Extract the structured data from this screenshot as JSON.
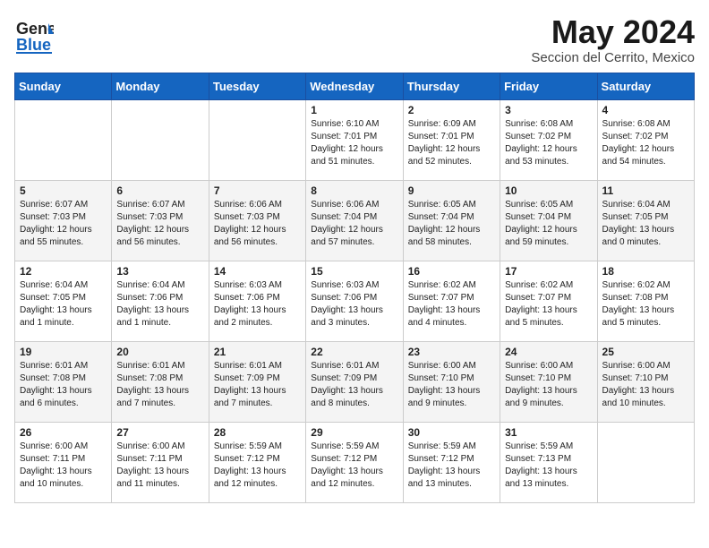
{
  "header": {
    "logo_line1": "General",
    "logo_line2": "Blue",
    "month": "May 2024",
    "location": "Seccion del Cerrito, Mexico"
  },
  "days_of_week": [
    "Sunday",
    "Monday",
    "Tuesday",
    "Wednesday",
    "Thursday",
    "Friday",
    "Saturday"
  ],
  "weeks": [
    [
      {
        "day": "",
        "info": ""
      },
      {
        "day": "",
        "info": ""
      },
      {
        "day": "",
        "info": ""
      },
      {
        "day": "1",
        "info": "Sunrise: 6:10 AM\nSunset: 7:01 PM\nDaylight: 12 hours\nand 51 minutes."
      },
      {
        "day": "2",
        "info": "Sunrise: 6:09 AM\nSunset: 7:01 PM\nDaylight: 12 hours\nand 52 minutes."
      },
      {
        "day": "3",
        "info": "Sunrise: 6:08 AM\nSunset: 7:02 PM\nDaylight: 12 hours\nand 53 minutes."
      },
      {
        "day": "4",
        "info": "Sunrise: 6:08 AM\nSunset: 7:02 PM\nDaylight: 12 hours\nand 54 minutes."
      }
    ],
    [
      {
        "day": "5",
        "info": "Sunrise: 6:07 AM\nSunset: 7:03 PM\nDaylight: 12 hours\nand 55 minutes."
      },
      {
        "day": "6",
        "info": "Sunrise: 6:07 AM\nSunset: 7:03 PM\nDaylight: 12 hours\nand 56 minutes."
      },
      {
        "day": "7",
        "info": "Sunrise: 6:06 AM\nSunset: 7:03 PM\nDaylight: 12 hours\nand 56 minutes."
      },
      {
        "day": "8",
        "info": "Sunrise: 6:06 AM\nSunset: 7:04 PM\nDaylight: 12 hours\nand 57 minutes."
      },
      {
        "day": "9",
        "info": "Sunrise: 6:05 AM\nSunset: 7:04 PM\nDaylight: 12 hours\nand 58 minutes."
      },
      {
        "day": "10",
        "info": "Sunrise: 6:05 AM\nSunset: 7:04 PM\nDaylight: 12 hours\nand 59 minutes."
      },
      {
        "day": "11",
        "info": "Sunrise: 6:04 AM\nSunset: 7:05 PM\nDaylight: 13 hours\nand 0 minutes."
      }
    ],
    [
      {
        "day": "12",
        "info": "Sunrise: 6:04 AM\nSunset: 7:05 PM\nDaylight: 13 hours\nand 1 minute."
      },
      {
        "day": "13",
        "info": "Sunrise: 6:04 AM\nSunset: 7:06 PM\nDaylight: 13 hours\nand 1 minute."
      },
      {
        "day": "14",
        "info": "Sunrise: 6:03 AM\nSunset: 7:06 PM\nDaylight: 13 hours\nand 2 minutes."
      },
      {
        "day": "15",
        "info": "Sunrise: 6:03 AM\nSunset: 7:06 PM\nDaylight: 13 hours\nand 3 minutes."
      },
      {
        "day": "16",
        "info": "Sunrise: 6:02 AM\nSunset: 7:07 PM\nDaylight: 13 hours\nand 4 minutes."
      },
      {
        "day": "17",
        "info": "Sunrise: 6:02 AM\nSunset: 7:07 PM\nDaylight: 13 hours\nand 5 minutes."
      },
      {
        "day": "18",
        "info": "Sunrise: 6:02 AM\nSunset: 7:08 PM\nDaylight: 13 hours\nand 5 minutes."
      }
    ],
    [
      {
        "day": "19",
        "info": "Sunrise: 6:01 AM\nSunset: 7:08 PM\nDaylight: 13 hours\nand 6 minutes."
      },
      {
        "day": "20",
        "info": "Sunrise: 6:01 AM\nSunset: 7:08 PM\nDaylight: 13 hours\nand 7 minutes."
      },
      {
        "day": "21",
        "info": "Sunrise: 6:01 AM\nSunset: 7:09 PM\nDaylight: 13 hours\nand 7 minutes."
      },
      {
        "day": "22",
        "info": "Sunrise: 6:01 AM\nSunset: 7:09 PM\nDaylight: 13 hours\nand 8 minutes."
      },
      {
        "day": "23",
        "info": "Sunrise: 6:00 AM\nSunset: 7:10 PM\nDaylight: 13 hours\nand 9 minutes."
      },
      {
        "day": "24",
        "info": "Sunrise: 6:00 AM\nSunset: 7:10 PM\nDaylight: 13 hours\nand 9 minutes."
      },
      {
        "day": "25",
        "info": "Sunrise: 6:00 AM\nSunset: 7:10 PM\nDaylight: 13 hours\nand 10 minutes."
      }
    ],
    [
      {
        "day": "26",
        "info": "Sunrise: 6:00 AM\nSunset: 7:11 PM\nDaylight: 13 hours\nand 10 minutes."
      },
      {
        "day": "27",
        "info": "Sunrise: 6:00 AM\nSunset: 7:11 PM\nDaylight: 13 hours\nand 11 minutes."
      },
      {
        "day": "28",
        "info": "Sunrise: 5:59 AM\nSunset: 7:12 PM\nDaylight: 13 hours\nand 12 minutes."
      },
      {
        "day": "29",
        "info": "Sunrise: 5:59 AM\nSunset: 7:12 PM\nDaylight: 13 hours\nand 12 minutes."
      },
      {
        "day": "30",
        "info": "Sunrise: 5:59 AM\nSunset: 7:12 PM\nDaylight: 13 hours\nand 13 minutes."
      },
      {
        "day": "31",
        "info": "Sunrise: 5:59 AM\nSunset: 7:13 PM\nDaylight: 13 hours\nand 13 minutes."
      },
      {
        "day": "",
        "info": ""
      }
    ]
  ]
}
